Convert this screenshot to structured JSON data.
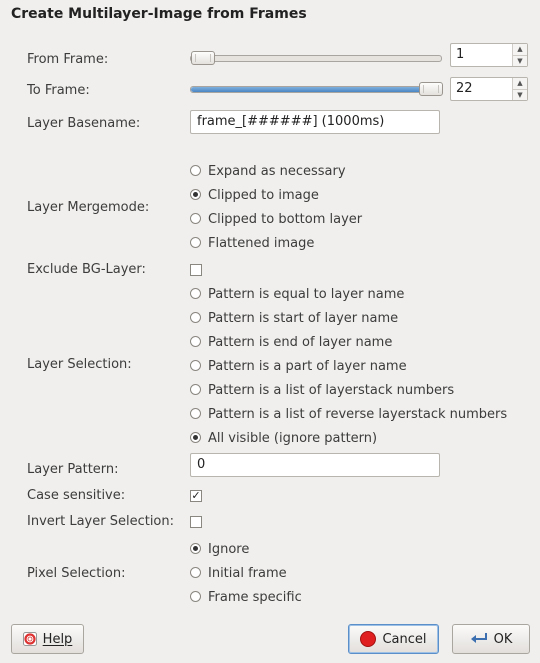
{
  "dialog": {
    "title": "Create Multilayer-Image from Frames"
  },
  "from_frame": {
    "label": "From Frame:",
    "value": "1",
    "slider_fraction": 0.0
  },
  "to_frame": {
    "label": "To Frame:",
    "value": "22",
    "slider_fraction": 1.0
  },
  "layer_basename": {
    "label": "Layer Basename:",
    "value": "frame_[######] (1000ms)"
  },
  "layer_mergemode": {
    "label": "Layer Mergemode:",
    "options": [
      "Expand as necessary",
      "Clipped to image",
      "Clipped to bottom layer",
      "Flattened image"
    ],
    "selected": 1
  },
  "exclude_bg": {
    "label": "Exclude BG-Layer:",
    "checked": false
  },
  "layer_selection": {
    "label": "Layer Selection:",
    "options": [
      "Pattern is equal to layer name",
      "Pattern is start of layer name",
      "Pattern is end of layer name",
      "Pattern is a part of layer name",
      "Pattern is a list of layerstack numbers",
      "Pattern is a list of reverse layerstack numbers",
      "All visible (ignore pattern)"
    ],
    "selected": 6
  },
  "layer_pattern": {
    "label": "Layer Pattern:",
    "value": "0"
  },
  "case_sensitive": {
    "label": "Case sensitive:",
    "checked": true
  },
  "invert_selection": {
    "label": "Invert Layer Selection:",
    "checked": false
  },
  "pixel_selection": {
    "label": "Pixel Selection:",
    "options": [
      "Ignore",
      "Initial frame",
      "Frame specific"
    ],
    "selected": 0
  },
  "buttons": {
    "help": "Help",
    "cancel": "Cancel",
    "ok": "OK"
  },
  "icons": {
    "help": "lifebuoy-icon",
    "cancel": "stop-icon",
    "ok": "return-arrow-icon"
  },
  "colors": {
    "slider_fill": "#4a86c4",
    "cancel_icon": "#e02020",
    "focus": "#5b8fc9"
  }
}
